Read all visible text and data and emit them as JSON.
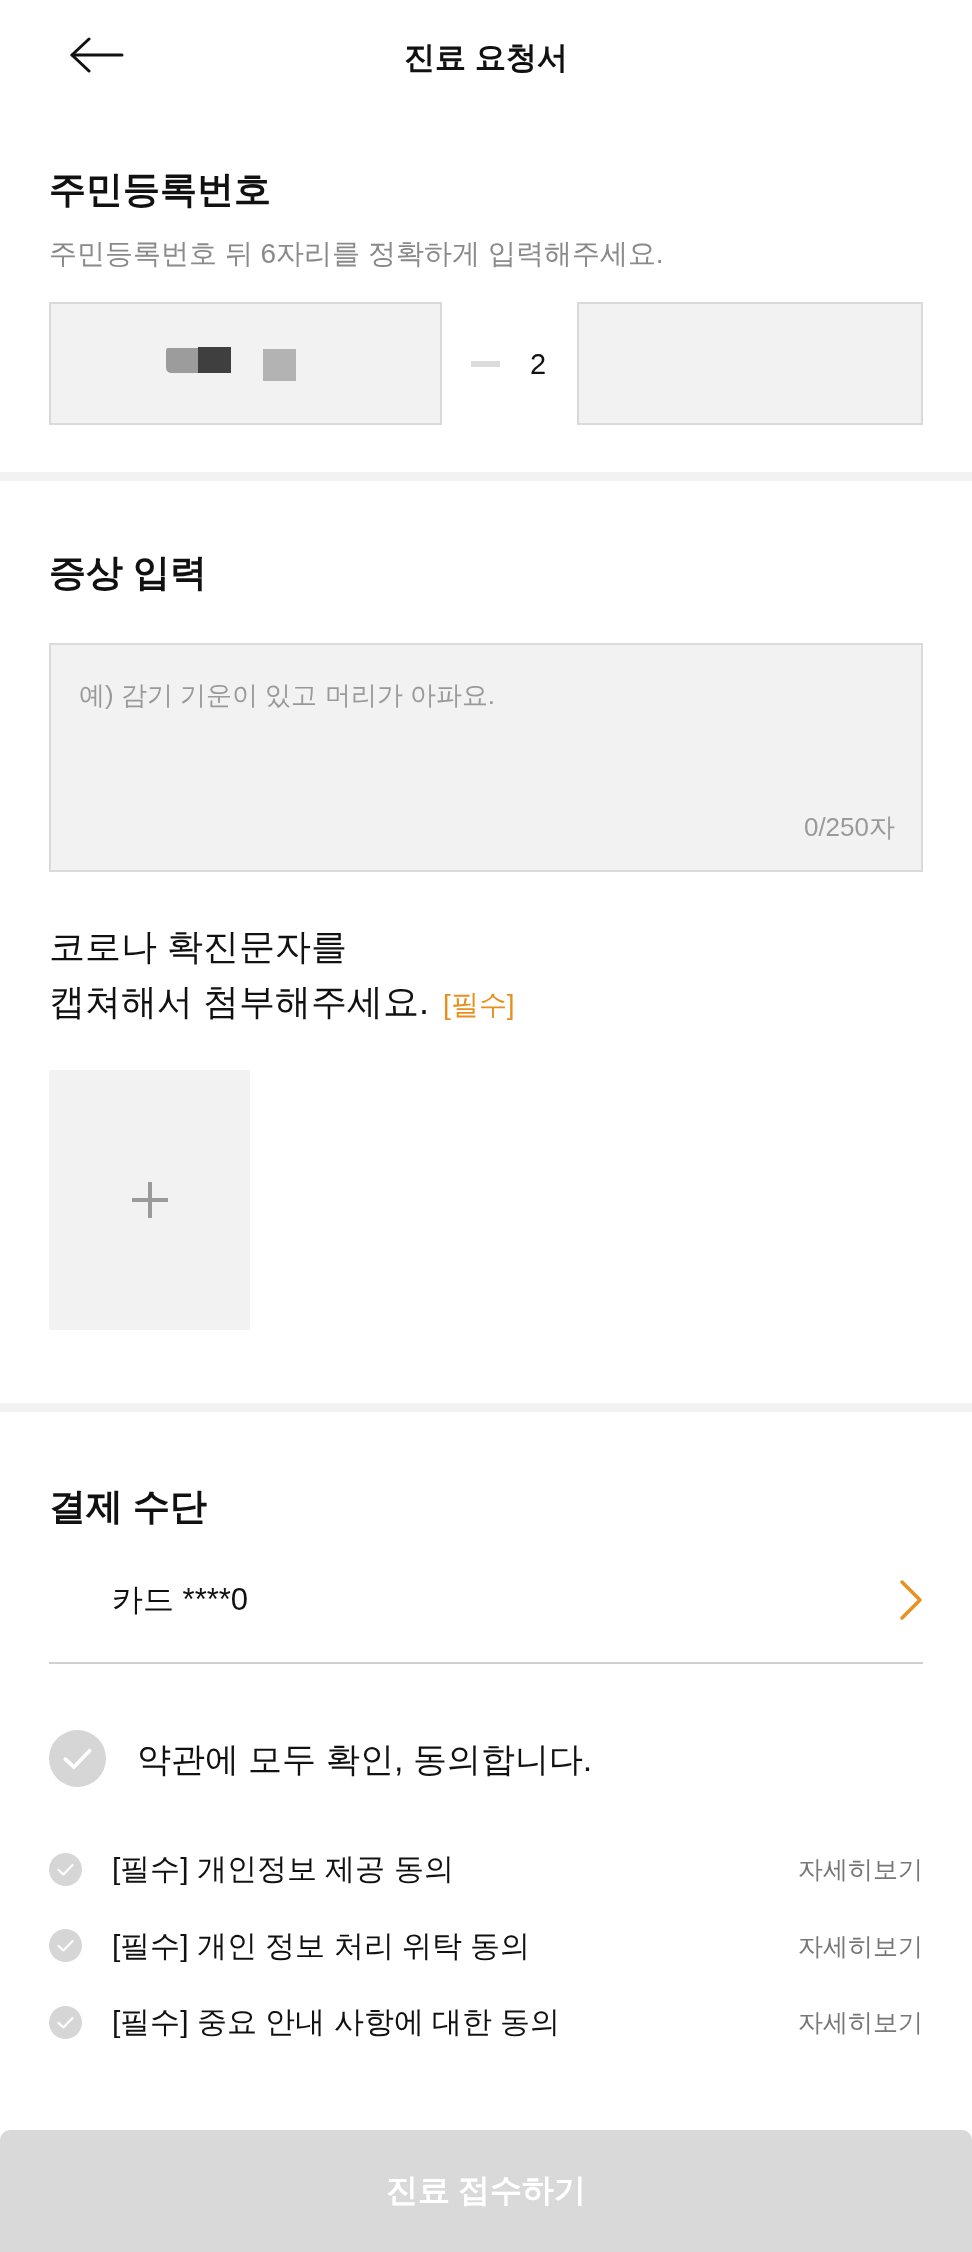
{
  "header": {
    "title": "진료 요청서"
  },
  "resident_number": {
    "heading": "주민등록번호",
    "hint": "주민등록번호 뒤 6자리를 정확하게 입력해주세요.",
    "front_field": {
      "masked": true
    },
    "back_first_digit": "2",
    "back_field": {
      "masked": false
    }
  },
  "symptoms": {
    "heading": "증상 입력",
    "placeholder": "예) 감기 기운이 있고 머리가 아파요.",
    "counter": "0/250자"
  },
  "attachment": {
    "heading": "코로나 확진문자를\n캡쳐해서 첨부해주세요.",
    "required_tag": "[필수]"
  },
  "payment": {
    "heading": "결제 수단",
    "card": "카드 ****0"
  },
  "terms": {
    "all": {
      "label": "약관에 모두 확인, 동의합니다.",
      "checked": false
    },
    "items": [
      {
        "label": "[필수] 개인정보 제공 동의",
        "link": "자세히보기",
        "checked": false
      },
      {
        "label": "[필수] 개인 정보 처리 위탁 동의",
        "link": "자세히보기",
        "checked": false
      },
      {
        "label": "[필수] 중요 안내 사항에 대한 동의",
        "link": "자세히보기",
        "checked": false
      }
    ]
  },
  "submit": {
    "label": "진료 접수하기",
    "disabled": true
  }
}
